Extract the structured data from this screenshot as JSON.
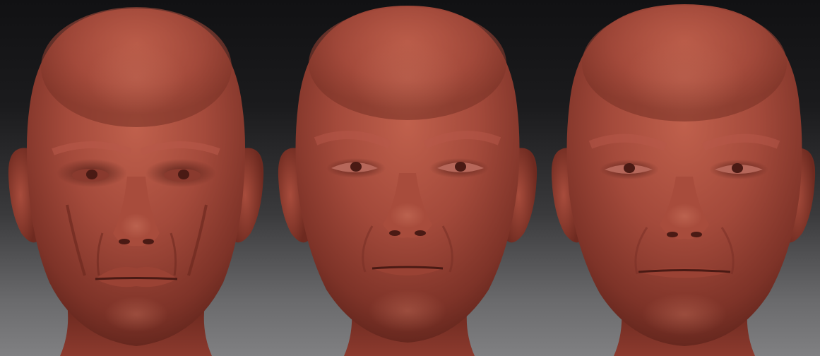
{
  "scene": {
    "background_top": "#111113",
    "background_bottom": "#808082",
    "material_color": "#a0473a",
    "heads": [
      {
        "name": "head-sculpt-left",
        "variant": "aged-gaunt"
      },
      {
        "name": "head-sculpt-middle",
        "variant": "smooth-neutral"
      },
      {
        "name": "head-sculpt-right",
        "variant": "smooth-broad"
      }
    ]
  }
}
